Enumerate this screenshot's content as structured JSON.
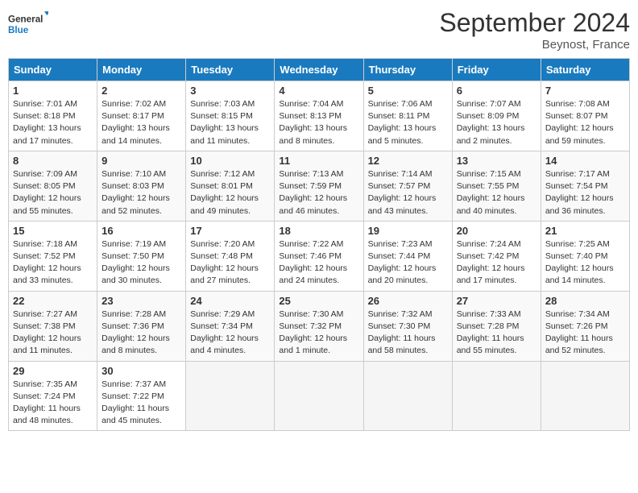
{
  "header": {
    "logo_line1": "General",
    "logo_line2": "Blue",
    "month": "September 2024",
    "location": "Beynost, France"
  },
  "days_of_week": [
    "Sunday",
    "Monday",
    "Tuesday",
    "Wednesday",
    "Thursday",
    "Friday",
    "Saturday"
  ],
  "weeks": [
    [
      {
        "day": "1",
        "sunrise": "7:01 AM",
        "sunset": "8:18 PM",
        "daylight": "13 hours and 17 minutes."
      },
      {
        "day": "2",
        "sunrise": "7:02 AM",
        "sunset": "8:17 PM",
        "daylight": "13 hours and 14 minutes."
      },
      {
        "day": "3",
        "sunrise": "7:03 AM",
        "sunset": "8:15 PM",
        "daylight": "13 hours and 11 minutes."
      },
      {
        "day": "4",
        "sunrise": "7:04 AM",
        "sunset": "8:13 PM",
        "daylight": "13 hours and 8 minutes."
      },
      {
        "day": "5",
        "sunrise": "7:06 AM",
        "sunset": "8:11 PM",
        "daylight": "13 hours and 5 minutes."
      },
      {
        "day": "6",
        "sunrise": "7:07 AM",
        "sunset": "8:09 PM",
        "daylight": "13 hours and 2 minutes."
      },
      {
        "day": "7",
        "sunrise": "7:08 AM",
        "sunset": "8:07 PM",
        "daylight": "12 hours and 59 minutes."
      }
    ],
    [
      {
        "day": "8",
        "sunrise": "7:09 AM",
        "sunset": "8:05 PM",
        "daylight": "12 hours and 55 minutes."
      },
      {
        "day": "9",
        "sunrise": "7:10 AM",
        "sunset": "8:03 PM",
        "daylight": "12 hours and 52 minutes."
      },
      {
        "day": "10",
        "sunrise": "7:12 AM",
        "sunset": "8:01 PM",
        "daylight": "12 hours and 49 minutes."
      },
      {
        "day": "11",
        "sunrise": "7:13 AM",
        "sunset": "7:59 PM",
        "daylight": "12 hours and 46 minutes."
      },
      {
        "day": "12",
        "sunrise": "7:14 AM",
        "sunset": "7:57 PM",
        "daylight": "12 hours and 43 minutes."
      },
      {
        "day": "13",
        "sunrise": "7:15 AM",
        "sunset": "7:55 PM",
        "daylight": "12 hours and 40 minutes."
      },
      {
        "day": "14",
        "sunrise": "7:17 AM",
        "sunset": "7:54 PM",
        "daylight": "12 hours and 36 minutes."
      }
    ],
    [
      {
        "day": "15",
        "sunrise": "7:18 AM",
        "sunset": "7:52 PM",
        "daylight": "12 hours and 33 minutes."
      },
      {
        "day": "16",
        "sunrise": "7:19 AM",
        "sunset": "7:50 PM",
        "daylight": "12 hours and 30 minutes."
      },
      {
        "day": "17",
        "sunrise": "7:20 AM",
        "sunset": "7:48 PM",
        "daylight": "12 hours and 27 minutes."
      },
      {
        "day": "18",
        "sunrise": "7:22 AM",
        "sunset": "7:46 PM",
        "daylight": "12 hours and 24 minutes."
      },
      {
        "day": "19",
        "sunrise": "7:23 AM",
        "sunset": "7:44 PM",
        "daylight": "12 hours and 20 minutes."
      },
      {
        "day": "20",
        "sunrise": "7:24 AM",
        "sunset": "7:42 PM",
        "daylight": "12 hours and 17 minutes."
      },
      {
        "day": "21",
        "sunrise": "7:25 AM",
        "sunset": "7:40 PM",
        "daylight": "12 hours and 14 minutes."
      }
    ],
    [
      {
        "day": "22",
        "sunrise": "7:27 AM",
        "sunset": "7:38 PM",
        "daylight": "12 hours and 11 minutes."
      },
      {
        "day": "23",
        "sunrise": "7:28 AM",
        "sunset": "7:36 PM",
        "daylight": "12 hours and 8 minutes."
      },
      {
        "day": "24",
        "sunrise": "7:29 AM",
        "sunset": "7:34 PM",
        "daylight": "12 hours and 4 minutes."
      },
      {
        "day": "25",
        "sunrise": "7:30 AM",
        "sunset": "7:32 PM",
        "daylight": "12 hours and 1 minute."
      },
      {
        "day": "26",
        "sunrise": "7:32 AM",
        "sunset": "7:30 PM",
        "daylight": "11 hours and 58 minutes."
      },
      {
        "day": "27",
        "sunrise": "7:33 AM",
        "sunset": "7:28 PM",
        "daylight": "11 hours and 55 minutes."
      },
      {
        "day": "28",
        "sunrise": "7:34 AM",
        "sunset": "7:26 PM",
        "daylight": "11 hours and 52 minutes."
      }
    ],
    [
      {
        "day": "29",
        "sunrise": "7:35 AM",
        "sunset": "7:24 PM",
        "daylight": "11 hours and 48 minutes."
      },
      {
        "day": "30",
        "sunrise": "7:37 AM",
        "sunset": "7:22 PM",
        "daylight": "11 hours and 45 minutes."
      },
      null,
      null,
      null,
      null,
      null
    ]
  ]
}
